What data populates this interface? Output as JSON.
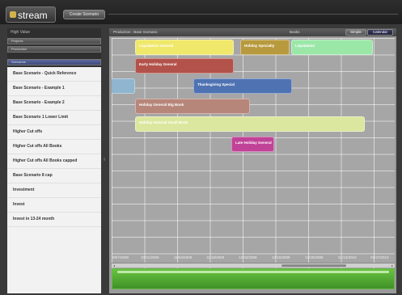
{
  "app": {
    "logo": "stream",
    "top_button": "Create Scenario"
  },
  "left_panel": {
    "header": "High Value",
    "accordions": [
      "Projects",
      "Production",
      "Scenarios"
    ],
    "scenarios": [
      "Base Scenario - Quick Reference",
      "Base Scenario - Example 1",
      "Base Scenario - Example 2",
      "Base Scenario 1 Lower Limit",
      "Higher Cut offs",
      "Higher Cut offs All Books",
      "Higher Cut offs All Books capped",
      "Base Scenario 8 cap",
      "Investment",
      "Invest",
      "Invest in 13-24 month"
    ]
  },
  "right_panel": {
    "title": "Production : Base Scenario",
    "label": "Books",
    "views": {
      "simple": "Simple",
      "calendar": "Calendar"
    },
    "dates": [
      "09/7/2009",
      "10/21/2009",
      "11/04/2009",
      "11/18/2009",
      "12/02/2009",
      "12/16/2009",
      "12/30/2009",
      "01/13/2010",
      "01/27/2010"
    ],
    "bars": [
      {
        "label": "Liquidation General",
        "color": "#efe86a",
        "text_color": "#ffffff"
      },
      {
        "label": "Holiday Specialty",
        "color": "#b89a3e",
        "text_color": "#ffffff"
      },
      {
        "label": "Liquidation",
        "color": "#9be7a8",
        "text_color": "#ffffff"
      },
      {
        "label": "Early Holiday General",
        "color": "#b2524a",
        "text_color": "#ffffff"
      },
      {
        "label": "",
        "color": "#8fb5cf",
        "text_color": "#ffffff"
      },
      {
        "label": "Thanksgiving Special",
        "color": "#4f72b2",
        "text_color": "#ffffff"
      },
      {
        "label": "Holiday General Big Book",
        "color": "#b7867a",
        "text_color": "#ffffff"
      },
      {
        "label": "Holiday General Small Book",
        "color": "#dbe79e",
        "text_color": "#ffffff"
      },
      {
        "label": "Late Holiday General",
        "color": "#c04397",
        "text_color": "#ffffff"
      }
    ]
  }
}
